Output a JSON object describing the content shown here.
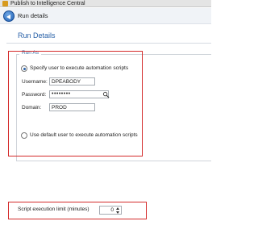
{
  "window": {
    "title": "Publish to Intelligence Central",
    "icon": "app-icon"
  },
  "header": {
    "step_label": "Run details",
    "back_icon": "back-arrow-icon"
  },
  "main": {
    "section_title": "Run Details"
  },
  "run_as": {
    "legend": "Run As",
    "specify_option": {
      "label": "Specify user to execute automation scripts",
      "checked": true
    },
    "username": {
      "label": "Username:",
      "value": "DPEABODY"
    },
    "password": {
      "label": "Password:",
      "value": "••••••••",
      "reveal_icon": "eye-icon"
    },
    "domain": {
      "label": "Domain:",
      "value": "PROD"
    },
    "default_option": {
      "label": "Use default user to execute automation scripts",
      "checked": false
    }
  },
  "script_limit": {
    "label": "Script execution limit (minutes)",
    "value": "0"
  },
  "colors": {
    "accent": "#2a62a8",
    "highlight": "#d42a2a"
  }
}
